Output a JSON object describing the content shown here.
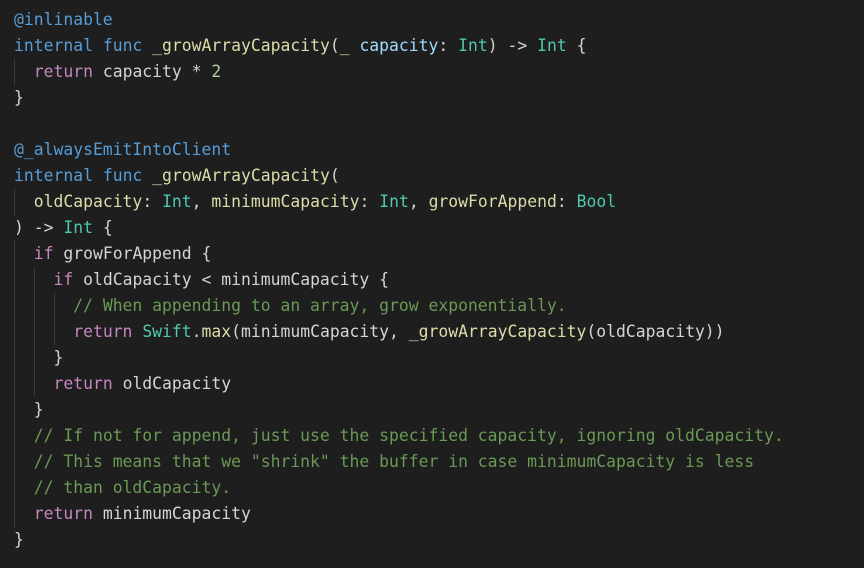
{
  "editor": {
    "lines": [
      {
        "indent": 0,
        "tokens": [
          {
            "t": "@inlinable",
            "c": "attr"
          }
        ]
      },
      {
        "indent": 0,
        "tokens": [
          {
            "t": "internal",
            "c": "kw"
          },
          {
            "t": " ",
            "c": "plain"
          },
          {
            "t": "func",
            "c": "kw"
          },
          {
            "t": " ",
            "c": "plain"
          },
          {
            "t": "_growArrayCapacity",
            "c": "fn"
          },
          {
            "t": "(",
            "c": "plain"
          },
          {
            "t": "_",
            "c": "fn"
          },
          {
            "t": " ",
            "c": "plain"
          },
          {
            "t": "capacity",
            "c": "param"
          },
          {
            "t": ": ",
            "c": "plain"
          },
          {
            "t": "Int",
            "c": "type"
          },
          {
            "t": ") -> ",
            "c": "plain"
          },
          {
            "t": "Int",
            "c": "type"
          },
          {
            "t": " {",
            "c": "plain"
          }
        ]
      },
      {
        "indent": 1,
        "tokens": [
          {
            "t": "return",
            "c": "kw2"
          },
          {
            "t": " capacity * ",
            "c": "plain"
          },
          {
            "t": "2",
            "c": "num"
          }
        ]
      },
      {
        "indent": 0,
        "tokens": [
          {
            "t": "}",
            "c": "plain"
          }
        ]
      },
      {
        "indent": 0,
        "tokens": []
      },
      {
        "indent": 0,
        "tokens": [
          {
            "t": "@_alwaysEmitIntoClient",
            "c": "attr"
          }
        ]
      },
      {
        "indent": 0,
        "tokens": [
          {
            "t": "internal",
            "c": "kw"
          },
          {
            "t": " ",
            "c": "plain"
          },
          {
            "t": "func",
            "c": "kw"
          },
          {
            "t": " ",
            "c": "plain"
          },
          {
            "t": "_growArrayCapacity",
            "c": "fn"
          },
          {
            "t": "(",
            "c": "plain"
          }
        ]
      },
      {
        "indent": 1,
        "tokens": [
          {
            "t": "oldCapacity",
            "c": "fn"
          },
          {
            "t": ": ",
            "c": "plain"
          },
          {
            "t": "Int",
            "c": "type"
          },
          {
            "t": ", ",
            "c": "plain"
          },
          {
            "t": "minimumCapacity",
            "c": "fn"
          },
          {
            "t": ": ",
            "c": "plain"
          },
          {
            "t": "Int",
            "c": "type"
          },
          {
            "t": ", ",
            "c": "plain"
          },
          {
            "t": "growForAppend",
            "c": "fn"
          },
          {
            "t": ": ",
            "c": "plain"
          },
          {
            "t": "Bool",
            "c": "type"
          }
        ]
      },
      {
        "indent": 0,
        "tokens": [
          {
            "t": ") -> ",
            "c": "plain"
          },
          {
            "t": "Int",
            "c": "type"
          },
          {
            "t": " {",
            "c": "plain"
          }
        ]
      },
      {
        "indent": 1,
        "tokens": [
          {
            "t": "if",
            "c": "kw2"
          },
          {
            "t": " growForAppend {",
            "c": "plain"
          }
        ]
      },
      {
        "indent": 2,
        "tokens": [
          {
            "t": "if",
            "c": "kw2"
          },
          {
            "t": " oldCapacity < minimumCapacity {",
            "c": "plain"
          }
        ]
      },
      {
        "indent": 3,
        "tokens": [
          {
            "t": "// When appending to an array, grow exponentially.",
            "c": "cm"
          }
        ]
      },
      {
        "indent": 3,
        "tokens": [
          {
            "t": "return",
            "c": "kw2"
          },
          {
            "t": " ",
            "c": "plain"
          },
          {
            "t": "Swift",
            "c": "type"
          },
          {
            "t": ".",
            "c": "plain"
          },
          {
            "t": "max",
            "c": "prop"
          },
          {
            "t": "(minimumCapacity, ",
            "c": "plain"
          },
          {
            "t": "_growArrayCapacity",
            "c": "fn"
          },
          {
            "t": "(oldCapacity))",
            "c": "plain"
          }
        ]
      },
      {
        "indent": 2,
        "tokens": [
          {
            "t": "}",
            "c": "plain"
          }
        ]
      },
      {
        "indent": 2,
        "tokens": [
          {
            "t": "return",
            "c": "kw2"
          },
          {
            "t": " oldCapacity",
            "c": "plain"
          }
        ]
      },
      {
        "indent": 1,
        "tokens": [
          {
            "t": "}",
            "c": "plain"
          }
        ]
      },
      {
        "indent": 1,
        "tokens": [
          {
            "t": "// If not for append, just use the specified capacity, ignoring oldCapacity.",
            "c": "cm"
          }
        ]
      },
      {
        "indent": 1,
        "tokens": [
          {
            "t": "// This means that we \"shrink\" the buffer in case minimumCapacity is less",
            "c": "cm"
          }
        ]
      },
      {
        "indent": 1,
        "tokens": [
          {
            "t": "// than oldCapacity.",
            "c": "cm"
          }
        ]
      },
      {
        "indent": 1,
        "tokens": [
          {
            "t": "return",
            "c": "kw2"
          },
          {
            "t": " minimumCapacity",
            "c": "plain"
          }
        ]
      },
      {
        "indent": 0,
        "tokens": [
          {
            "t": "}",
            "c": "plain"
          }
        ]
      }
    ]
  },
  "colors": {
    "background": "#1e1e1e",
    "attribute": "#569cd6",
    "keyword": "#569cd6",
    "control_keyword": "#c586c0",
    "function": "#dcdcaa",
    "type": "#4ec9b0",
    "parameter": "#9cdcfe",
    "number": "#b5cea8",
    "comment": "#6a9955",
    "plain": "#d4d4d4"
  }
}
